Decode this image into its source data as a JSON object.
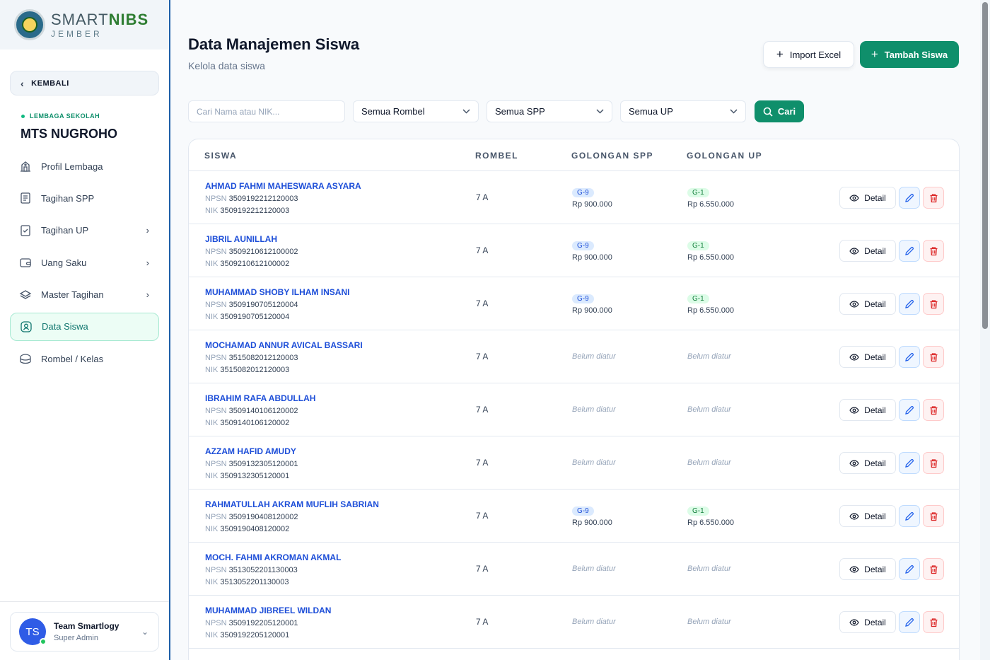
{
  "brand": {
    "name_light": "SMART",
    "name_bold": "NIBS",
    "sub": "JEMBER"
  },
  "sidebar": {
    "back_label": "KEMBALI",
    "lembaga_label": "LEMBAGA SEKOLAH",
    "school_name": "MTS NUGROHO",
    "items": [
      {
        "label": "Profil Lembaga",
        "icon": "building-icon",
        "has_arrow": false
      },
      {
        "label": "Tagihan SPP",
        "icon": "receipt-icon",
        "has_arrow": false
      },
      {
        "label": "Tagihan UP",
        "icon": "checklist-icon",
        "has_arrow": true
      },
      {
        "label": "Uang Saku",
        "icon": "wallet-icon",
        "has_arrow": true
      },
      {
        "label": "Master Tagihan",
        "icon": "layers-icon",
        "has_arrow": true
      },
      {
        "label": "Data Siswa",
        "icon": "user-badge-icon",
        "has_arrow": false,
        "active": true
      },
      {
        "label": "Rombel / Kelas",
        "icon": "class-icon",
        "has_arrow": false
      }
    ],
    "user": {
      "initials": "TS",
      "name": "Team Smartlogy",
      "role": "Super Admin"
    }
  },
  "header": {
    "title": "Data Manajemen Siswa",
    "subtitle": "Kelola data siswa",
    "import_label": "Import Excel",
    "add_label": "Tambah Siswa"
  },
  "filters": {
    "search_placeholder": "Cari Nama atau NIK...",
    "rombel": "Semua Rombel",
    "spp": "Semua SPP",
    "up": "Semua UP",
    "search_button": "Cari"
  },
  "table": {
    "headers": {
      "siswa": "SISWA",
      "rombel": "ROMBEL",
      "spp": "GOLONGAN SPP",
      "up": "GOLONGAN UP"
    },
    "npsn_label": "NPSN",
    "nik_label": "NIK",
    "unset_label": "Belum diatur",
    "detail_label": "Detail",
    "rows": [
      {
        "name": "AHMAD FAHMI MAHESWARA ASYARA",
        "npsn": "3509192212120003",
        "nik": "3509192212120003",
        "rombel": "7 A",
        "spp_code": "G-9",
        "spp_amount": "Rp 900.000",
        "up_code": "G-1",
        "up_amount": "Rp 6.550.000"
      },
      {
        "name": "JIBRIL AUNILLAH",
        "npsn": "3509210612100002",
        "nik": "3509210612100002",
        "rombel": "7 A",
        "spp_code": "G-9",
        "spp_amount": "Rp 900.000",
        "up_code": "G-1",
        "up_amount": "Rp 6.550.000"
      },
      {
        "name": "MUHAMMAD SHOBY ILHAM INSANI",
        "npsn": "3509190705120004",
        "nik": "3509190705120004",
        "rombel": "7 A",
        "spp_code": "G-9",
        "spp_amount": "Rp 900.000",
        "up_code": "G-1",
        "up_amount": "Rp 6.550.000"
      },
      {
        "name": "MOCHAMAD ANNUR AVICAL BASSARI",
        "npsn": "3515082012120003",
        "nik": "3515082012120003",
        "rombel": "7 A",
        "spp_code": null,
        "spp_amount": null,
        "up_code": null,
        "up_amount": null
      },
      {
        "name": "IBRAHIM RAFA ABDULLAH",
        "npsn": "3509140106120002",
        "nik": "3509140106120002",
        "rombel": "7 A",
        "spp_code": null,
        "spp_amount": null,
        "up_code": null,
        "up_amount": null
      },
      {
        "name": "AZZAM HAFID AMUDY",
        "npsn": "3509132305120001",
        "nik": "3509132305120001",
        "rombel": "7 A",
        "spp_code": null,
        "spp_amount": null,
        "up_code": null,
        "up_amount": null
      },
      {
        "name": "RAHMATULLAH AKRAM MUFLIH SABRIAN",
        "npsn": "3509190408120002",
        "nik": "3509190408120002",
        "rombel": "7 A",
        "spp_code": "G-9",
        "spp_amount": "Rp 900.000",
        "up_code": "G-1",
        "up_amount": "Rp 6.550.000"
      },
      {
        "name": "MOCH. FAHMI AKROMAN AKMAL",
        "npsn": "3513052201130003",
        "nik": "3513052201130003",
        "rombel": "7 A",
        "spp_code": null,
        "spp_amount": null,
        "up_code": null,
        "up_amount": null
      },
      {
        "name": "MUHAMMAD JIBREEL WILDAN",
        "npsn": "3509192205120001",
        "nik": "3509192205120001",
        "rombel": "7 A",
        "spp_code": null,
        "spp_amount": null,
        "up_code": null,
        "up_amount": null
      }
    ]
  },
  "colors": {
    "accent": "#0f8f6b",
    "link": "#1d4ed8",
    "danger": "#dc2626"
  }
}
